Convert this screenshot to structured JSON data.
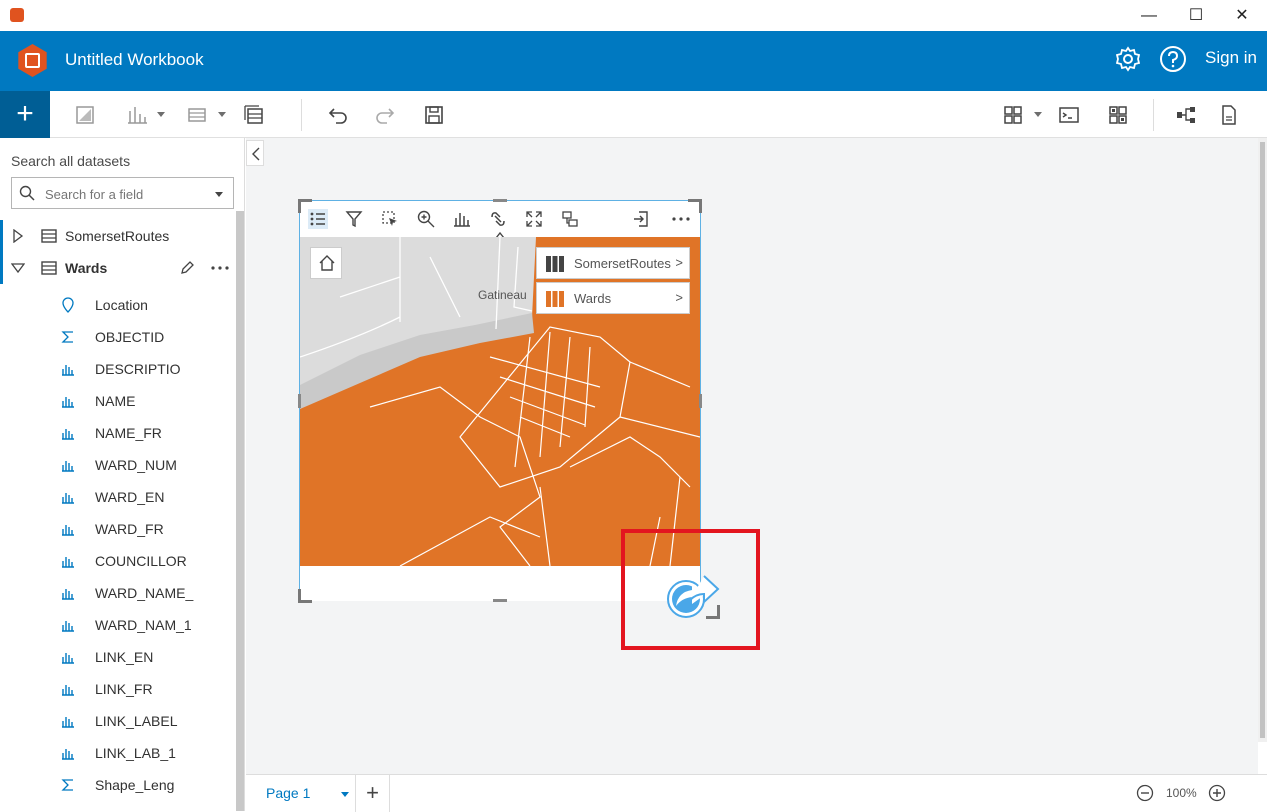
{
  "window": {
    "minimize": "—",
    "maximize": "☐",
    "close": "✕"
  },
  "header": {
    "title": "Untitled Workbook",
    "sign_in": "Sign in"
  },
  "sidebar": {
    "search_label": "Search all datasets",
    "search_placeholder": "Search for a field",
    "datasets": [
      {
        "name": "SomersetRoutes",
        "expanded": false
      },
      {
        "name": "Wards",
        "expanded": true
      }
    ],
    "fields": [
      {
        "name": "Location",
        "type": "location-icon"
      },
      {
        "name": "OBJECTID",
        "type": "sigma-icon"
      },
      {
        "name": "DESCRIPTIO",
        "type": "string-icon"
      },
      {
        "name": "NAME",
        "type": "string-icon"
      },
      {
        "name": "NAME_FR",
        "type": "string-icon"
      },
      {
        "name": "WARD_NUM",
        "type": "string-icon"
      },
      {
        "name": "WARD_EN",
        "type": "string-icon"
      },
      {
        "name": "WARD_FR",
        "type": "string-icon"
      },
      {
        "name": "COUNCILLOR",
        "type": "string-icon"
      },
      {
        "name": "WARD_NAME_",
        "type": "string-icon"
      },
      {
        "name": "WARD_NAM_1",
        "type": "string-icon"
      },
      {
        "name": "LINK_EN",
        "type": "string-icon"
      },
      {
        "name": "LINK_FR",
        "type": "string-icon"
      },
      {
        "name": "LINK_LABEL",
        "type": "string-icon"
      },
      {
        "name": "LINK_LAB_1",
        "type": "string-icon"
      },
      {
        "name": "Shape_Leng",
        "type": "sigma-icon"
      }
    ]
  },
  "map_card": {
    "place_label": "Gatineau",
    "legend": [
      {
        "name": "SomersetRoutes",
        "color": "#444444"
      },
      {
        "name": "Wards",
        "color": "#e07427"
      }
    ],
    "fill_color": "#e07427"
  },
  "footer": {
    "page_label": "Page 1",
    "add_page": "+",
    "zoom": "100%"
  },
  "colors": {
    "brand": "#0079c1",
    "highlight": "#e3151f"
  }
}
